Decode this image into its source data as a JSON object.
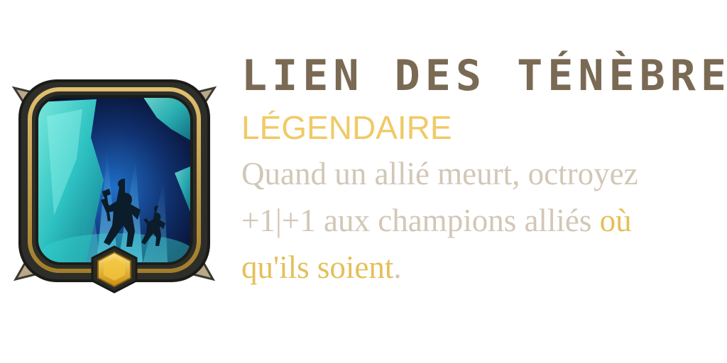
{
  "card": {
    "icon": "shadow-figures-portal-icon",
    "gem_icon": "hexagon-gem-icon",
    "title": "LIEN DES TÉNÈBRES",
    "rarity": "LÉGENDAIRE",
    "description": {
      "line1": "Quand un allié meurt, octroyez",
      "line2_plain": "+1|+1 aux champions alliés",
      "line2_highlight": "où",
      "line3_highlight": "qu'ils soient",
      "line3_plain": "."
    }
  },
  "colors": {
    "title": "#7a6a54",
    "rarity": "#f0ca66",
    "description": "#d2c7b7",
    "highlight": "#e4c059",
    "frame_gold": "#c9a23e",
    "portal_teal": "#3fd6cf"
  }
}
